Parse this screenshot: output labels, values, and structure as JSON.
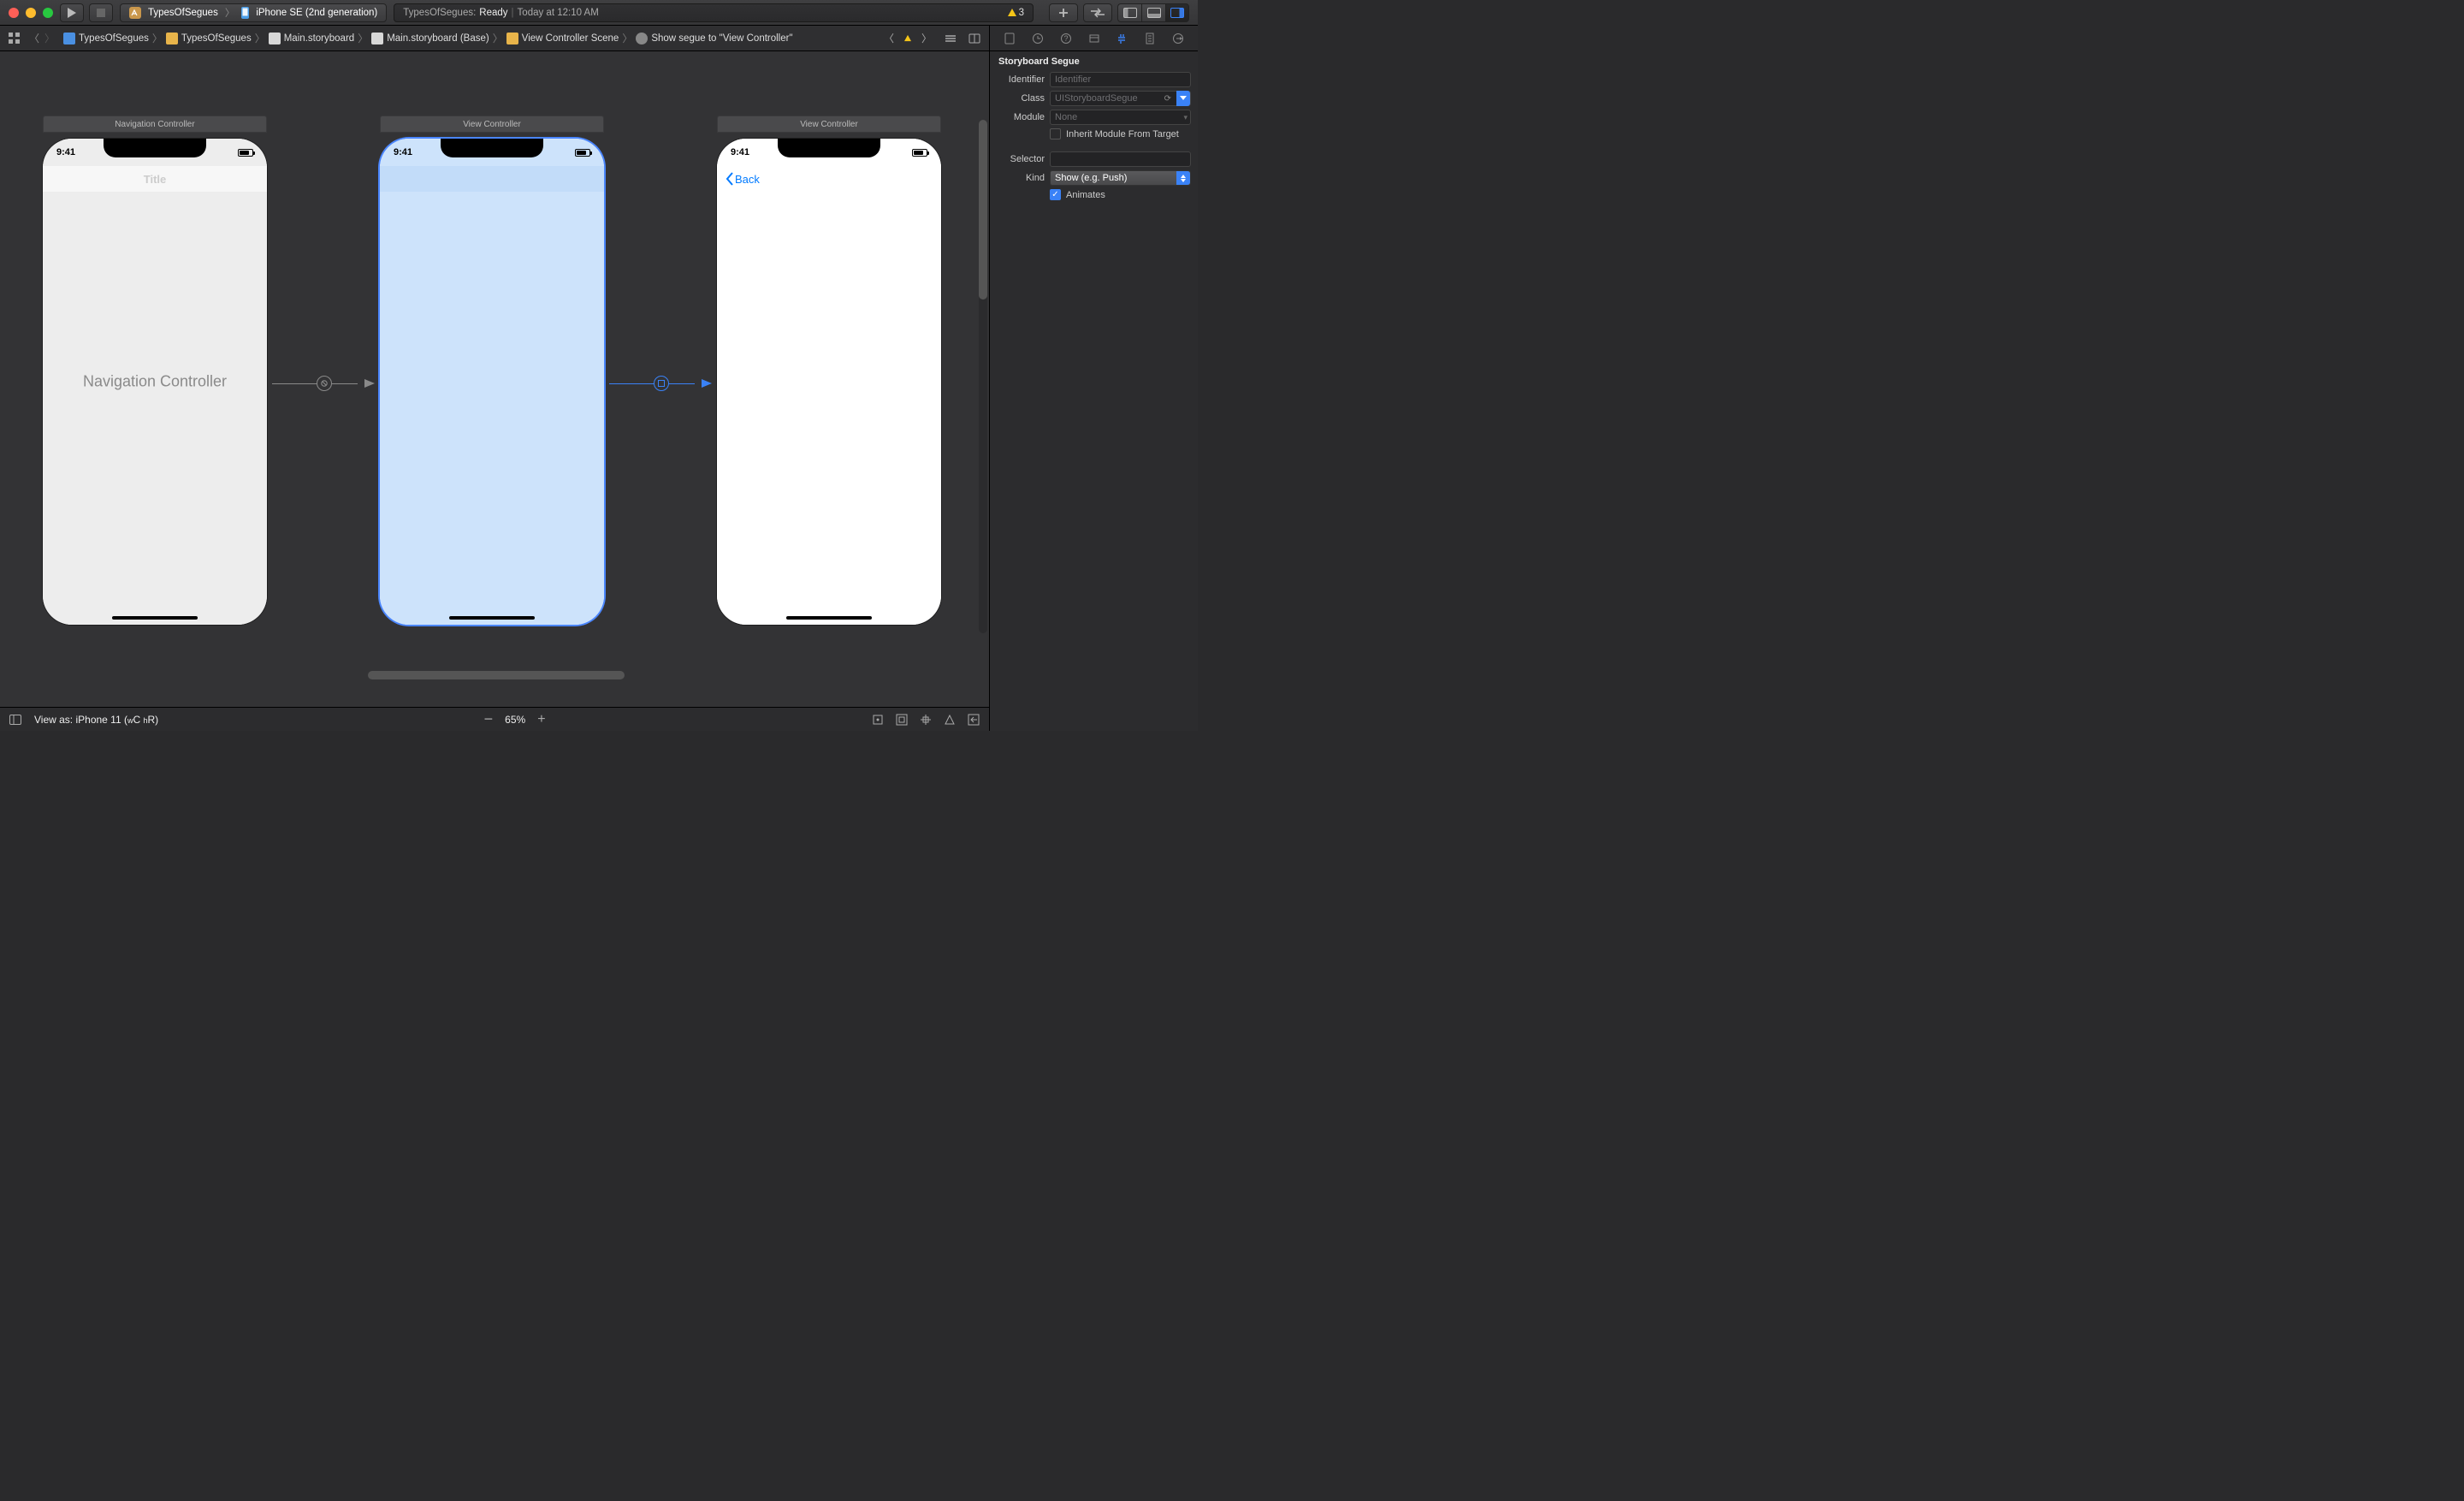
{
  "toolbar": {
    "scheme_app": "TypesOfSegues",
    "scheme_device": "iPhone SE (2nd generation)",
    "activity_prefix": "TypesOfSegues:",
    "activity_status": "Ready",
    "activity_sep": "|",
    "activity_time": "Today at 12:10 AM",
    "warning_count": "3"
  },
  "jumpbar": {
    "items": [
      "TypesOfSegues",
      "TypesOfSegues",
      "Main.storyboard",
      "Main.storyboard (Base)",
      "View Controller Scene",
      "Show segue to \"View Controller\""
    ]
  },
  "scenes": {
    "a": {
      "label": "Navigation Controller",
      "time": "9:41",
      "title": "Title",
      "body": "Navigation Controller"
    },
    "b": {
      "label": "View Controller",
      "time": "9:41"
    },
    "c": {
      "label": "View Controller",
      "time": "9:41",
      "back": "Back"
    }
  },
  "bottombar": {
    "view_as": "View as: iPhone 11 (",
    "view_as_wc": "C",
    "view_as_hr": "R",
    "close": ")",
    "zoom_pct": "65%"
  },
  "inspector": {
    "heading": "Storyboard Segue",
    "labels": {
      "identifier": "Identifier",
      "class": "Class",
      "module": "Module",
      "inherit": "Inherit Module From Target",
      "selector": "Selector",
      "kind": "Kind",
      "animates": "Animates"
    },
    "values": {
      "identifier_placeholder": "Identifier",
      "class_placeholder": "UIStoryboardSegue",
      "module_placeholder": "None",
      "kind": "Show (e.g. Push)"
    }
  }
}
